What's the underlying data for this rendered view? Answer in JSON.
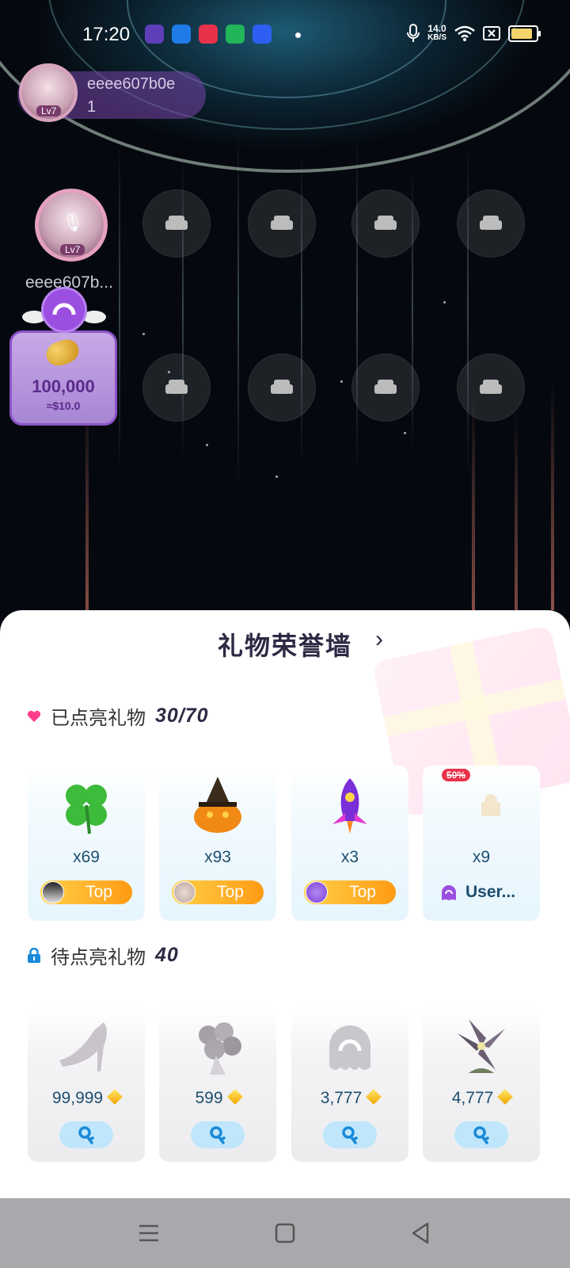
{
  "status_bar": {
    "time": "17:20",
    "net_speed_value": "14.0",
    "net_speed_unit": "KB/S",
    "icons": [
      "app-icon-purple",
      "app-icon-blue",
      "app-icon-red",
      "app-icon-green",
      "app-icon-baidu",
      "mic-icon",
      "wifi-icon",
      "sim-off-icon",
      "battery-icon"
    ],
    "battery_level": 0.85
  },
  "host": {
    "name": "eeee607b0e",
    "count": "1",
    "level": "Lv7"
  },
  "seat_main": {
    "name": "eeee607b...",
    "level": "Lv7"
  },
  "bean_card": {
    "amount": "100,000",
    "usd": "≈$10.0"
  },
  "gift_wall": {
    "title": "礼物荣誉墙",
    "lit_label": "已点亮礼物",
    "lit_count": "30/70",
    "unlit_label": "待点亮礼物",
    "unlit_count": "40",
    "lit_gifts": [
      {
        "icon": "clover-icon",
        "qty": "x69",
        "badge": "Top"
      },
      {
        "icon": "pumpkin-icon",
        "qty": "x93",
        "badge": "Top"
      },
      {
        "icon": "rocket-icon",
        "qty": "x3",
        "badge": "Top"
      },
      {
        "icon": "moon-mosque-icon",
        "qty": "x9",
        "badge": "User...",
        "discount": "50%"
      }
    ],
    "unlit_gifts": [
      {
        "icon": "high-heel-icon",
        "price": "99,999"
      },
      {
        "icon": "bouquet-icon",
        "price": "599"
      },
      {
        "icon": "ghost-mascot-icon",
        "price": "3,777"
      },
      {
        "icon": "lily-flower-icon",
        "price": "4,777"
      }
    ]
  },
  "colors": {
    "accent_orange": "#ff9b13",
    "accent_yellow": "#ffd24a",
    "heart_pink": "#ff3d8b",
    "lock_blue": "#1a8ad8",
    "light_button": "#bfe6fb"
  }
}
